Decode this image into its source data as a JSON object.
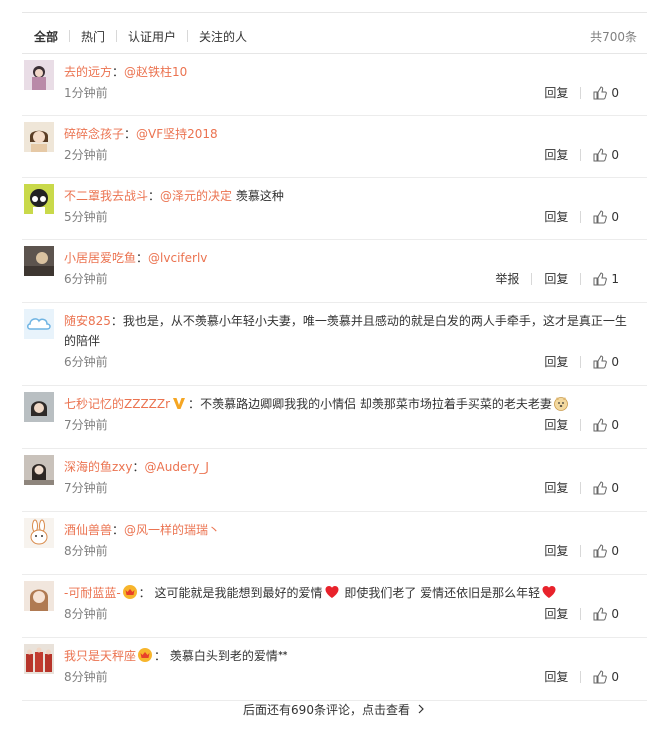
{
  "tabs": [
    {
      "label": "全部"
    },
    {
      "label": "热门"
    },
    {
      "label": "认证用户"
    },
    {
      "label": "关注的人"
    }
  ],
  "total": "共700条",
  "actions": {
    "reply": "回复",
    "report": "举报"
  },
  "comments": [
    {
      "user": "去的远方",
      "colon": "：",
      "at": "@赵铁柱10",
      "text": "",
      "time": "1分钟前",
      "likes": "0",
      "avatar_color": "#c9b8c4"
    },
    {
      "user": "碎碎念孩子",
      "colon": "：",
      "at": "@VF坚持2018",
      "text": "",
      "time": "2分钟前",
      "likes": "0",
      "avatar_color": "#d7c3a6"
    },
    {
      "user": "不二罩我去战斗",
      "colon": "：",
      "at": "@泽元的决定",
      "text": " 羡慕这种",
      "time": "5分钟前",
      "likes": "0",
      "avatar_color": "#c8d84a"
    },
    {
      "user": "小居居爱吃鱼",
      "colon": "：",
      "at": "@lvciferlv",
      "text": "",
      "time": "6分钟前",
      "likes": "1",
      "avatar_color": "#6b5e55"
    },
    {
      "user": "随安825",
      "colon": "：",
      "at": "",
      "text": "我也是，从不羡慕小年轻小夫妻，唯一羡慕并且感动的就是白发的两人手牵手，这才是真正一生的陪伴",
      "time": "6分钟前",
      "likes": "0",
      "avatar_color": "#8ec2e8"
    },
    {
      "user": "七秒记忆的ZZZZZr",
      "colon": "：",
      "at": "",
      "text": "不羡慕路边卿卿我我的小情侣 却羡那菜市场拉着手买菜的老夫老妻",
      "time": "7分钟前",
      "likes": "0",
      "avatar_color": "#9aa3a8"
    },
    {
      "user": "深海的鱼zxy",
      "colon": "：",
      "at": "@Audery_J",
      "text": "",
      "time": "7分钟前",
      "likes": "0",
      "avatar_color": "#b0a8a0"
    },
    {
      "user": "酒仙兽兽",
      "colon": "：",
      "at": "@风一样的瑞瑞丶",
      "text": "",
      "time": "8分钟前",
      "likes": "0",
      "avatar_color": "#f2efe9"
    },
    {
      "user": "-可耐蓝蓝-",
      "colon": "：",
      "at": "",
      "text": " 这可能就是我能想到最好的爱情",
      "text2": " 即使我们老了 爱情还依旧是那么年轻",
      "time": "8分钟前",
      "likes": "0",
      "avatar_color": "#e6d2c2"
    },
    {
      "user": "我只是天秤座",
      "colon": "：",
      "at": "",
      "text": " 羡慕白头到老的爱情ᕯ",
      "time": "8分钟前",
      "likes": "0",
      "avatar_color": "#b03a2e"
    }
  ],
  "footer": "后面还有690条评论，点击查看"
}
